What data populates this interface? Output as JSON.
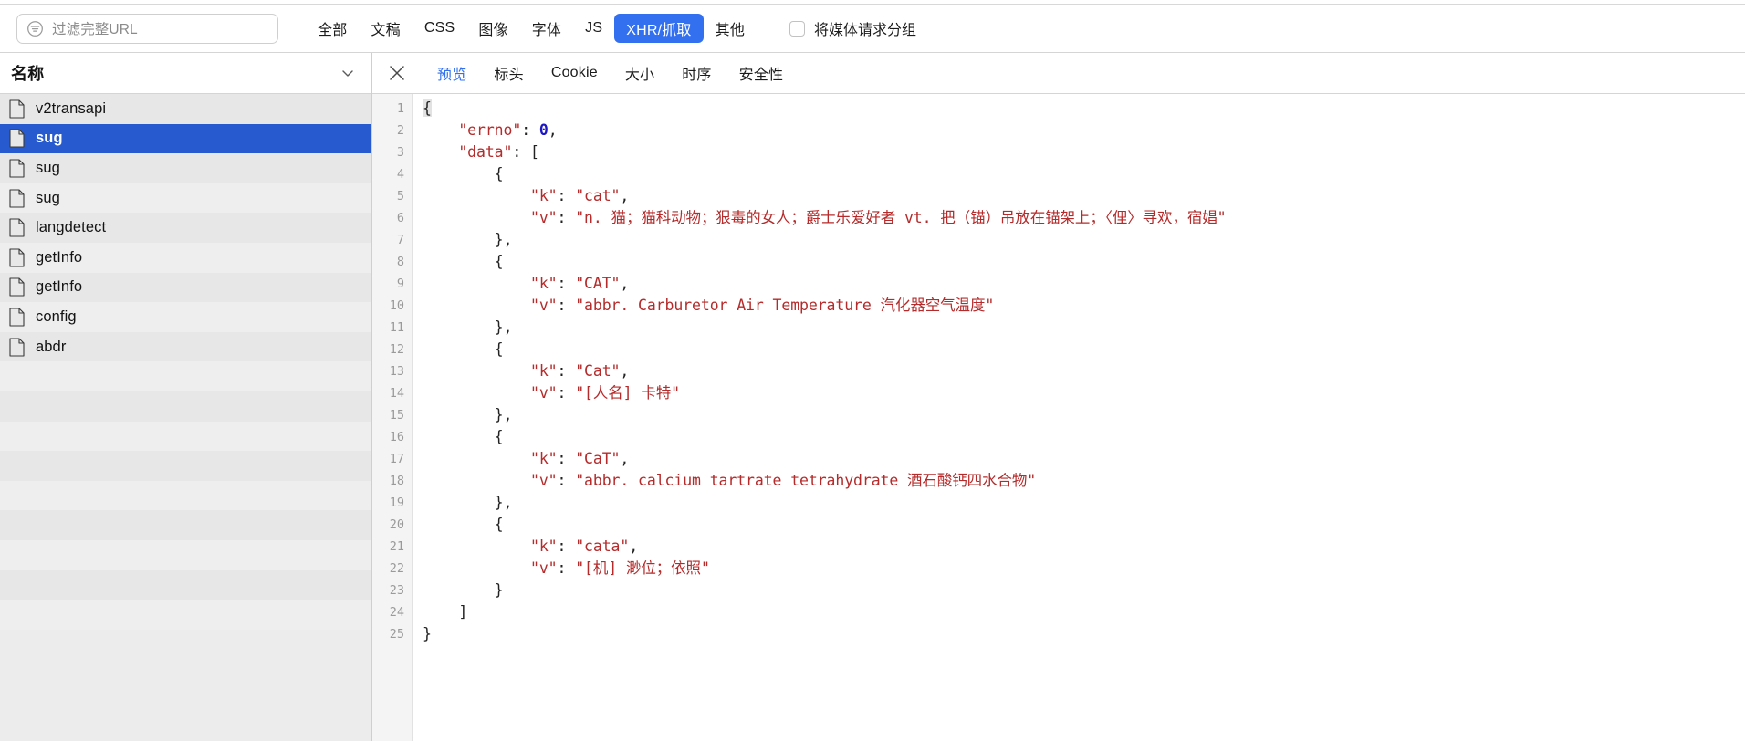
{
  "toolbar": {
    "filter": {
      "placeholder": "过滤完整URL",
      "value": "",
      "icon": "filter-icon"
    },
    "type_filters": [
      {
        "label": "全部",
        "active": false
      },
      {
        "label": "文稿",
        "active": false
      },
      {
        "label": "CSS",
        "active": false
      },
      {
        "label": "图像",
        "active": false
      },
      {
        "label": "字体",
        "active": false
      },
      {
        "label": "JS",
        "active": false
      },
      {
        "label": "XHR/抓取",
        "active": true
      },
      {
        "label": "其他",
        "active": false
      }
    ],
    "group_media": {
      "label": "将媒体请求分组",
      "checked": false
    },
    "active_accent": "#3370f0"
  },
  "sidebar": {
    "header": {
      "title": "名称",
      "collapse_icon": "chevron-down-icon"
    },
    "selected_index": 1,
    "selection_color": "#2759cf",
    "items": [
      {
        "name": "v2transapi"
      },
      {
        "name": "sug"
      },
      {
        "name": "sug"
      },
      {
        "name": "sug"
      },
      {
        "name": "langdetect"
      },
      {
        "name": "getInfo"
      },
      {
        "name": "getInfo"
      },
      {
        "name": "config"
      },
      {
        "name": "abdr"
      }
    ],
    "empty_rows": 9
  },
  "detail": {
    "close_icon": "close-icon",
    "tabs": [
      {
        "label": "预览",
        "active": true
      },
      {
        "label": "标头",
        "active": false
      },
      {
        "label": "Cookie",
        "active": false
      },
      {
        "label": "大小",
        "active": false
      },
      {
        "label": "时序",
        "active": false
      },
      {
        "label": "安全性",
        "active": false
      }
    ],
    "active_tab_color": "#3370f0"
  },
  "preview": {
    "string_color": "#b52b2b",
    "number_color": "#1c16c4",
    "punct_color": "#222222",
    "line_numbers": [
      1,
      2,
      3,
      4,
      5,
      6,
      7,
      8,
      9,
      10,
      11,
      12,
      13,
      14,
      15,
      16,
      17,
      18,
      19,
      20,
      21,
      22,
      23,
      24,
      25
    ],
    "lines": [
      {
        "n": 1,
        "indent": 0,
        "tokens": [
          {
            "t": "punc",
            "v": "{"
          }
        ],
        "first": true
      },
      {
        "n": 2,
        "indent": 1,
        "tokens": [
          {
            "t": "str",
            "v": "\"errno\""
          },
          {
            "t": "punc",
            "v": ": "
          },
          {
            "t": "num",
            "v": "0"
          },
          {
            "t": "punc",
            "v": ","
          }
        ]
      },
      {
        "n": 3,
        "indent": 1,
        "tokens": [
          {
            "t": "str",
            "v": "\"data\""
          },
          {
            "t": "punc",
            "v": ": ["
          }
        ]
      },
      {
        "n": 4,
        "indent": 2,
        "tokens": [
          {
            "t": "punc",
            "v": "{"
          }
        ]
      },
      {
        "n": 5,
        "indent": 3,
        "tokens": [
          {
            "t": "str",
            "v": "\"k\""
          },
          {
            "t": "punc",
            "v": ": "
          },
          {
            "t": "str",
            "v": "\"cat\""
          },
          {
            "t": "punc",
            "v": ","
          }
        ]
      },
      {
        "n": 6,
        "indent": 3,
        "tokens": [
          {
            "t": "str",
            "v": "\"v\""
          },
          {
            "t": "punc",
            "v": ": "
          },
          {
            "t": "str",
            "v": "\"n. 猫；猫科动物；狠毒的女人；爵士乐爱好者 vt. 把（锚）吊放在锚架上；〈俚〉寻欢，宿娼\""
          }
        ]
      },
      {
        "n": 7,
        "indent": 2,
        "tokens": [
          {
            "t": "punc",
            "v": "},"
          }
        ]
      },
      {
        "n": 8,
        "indent": 2,
        "tokens": [
          {
            "t": "punc",
            "v": "{"
          }
        ]
      },
      {
        "n": 9,
        "indent": 3,
        "tokens": [
          {
            "t": "str",
            "v": "\"k\""
          },
          {
            "t": "punc",
            "v": ": "
          },
          {
            "t": "str",
            "v": "\"CAT\""
          },
          {
            "t": "punc",
            "v": ","
          }
        ]
      },
      {
        "n": 10,
        "indent": 3,
        "tokens": [
          {
            "t": "str",
            "v": "\"v\""
          },
          {
            "t": "punc",
            "v": ": "
          },
          {
            "t": "str",
            "v": "\"abbr. Carburetor Air Temperature 汽化器空气温度\""
          }
        ]
      },
      {
        "n": 11,
        "indent": 2,
        "tokens": [
          {
            "t": "punc",
            "v": "},"
          }
        ]
      },
      {
        "n": 12,
        "indent": 2,
        "tokens": [
          {
            "t": "punc",
            "v": "{"
          }
        ]
      },
      {
        "n": 13,
        "indent": 3,
        "tokens": [
          {
            "t": "str",
            "v": "\"k\""
          },
          {
            "t": "punc",
            "v": ": "
          },
          {
            "t": "str",
            "v": "\"Cat\""
          },
          {
            "t": "punc",
            "v": ","
          }
        ]
      },
      {
        "n": 14,
        "indent": 3,
        "tokens": [
          {
            "t": "str",
            "v": "\"v\""
          },
          {
            "t": "punc",
            "v": ": "
          },
          {
            "t": "str",
            "v": "\"[人名] 卡特\""
          }
        ]
      },
      {
        "n": 15,
        "indent": 2,
        "tokens": [
          {
            "t": "punc",
            "v": "},"
          }
        ]
      },
      {
        "n": 16,
        "indent": 2,
        "tokens": [
          {
            "t": "punc",
            "v": "{"
          }
        ]
      },
      {
        "n": 17,
        "indent": 3,
        "tokens": [
          {
            "t": "str",
            "v": "\"k\""
          },
          {
            "t": "punc",
            "v": ": "
          },
          {
            "t": "str",
            "v": "\"CaT\""
          },
          {
            "t": "punc",
            "v": ","
          }
        ]
      },
      {
        "n": 18,
        "indent": 3,
        "tokens": [
          {
            "t": "str",
            "v": "\"v\""
          },
          {
            "t": "punc",
            "v": ": "
          },
          {
            "t": "str",
            "v": "\"abbr. calcium tartrate tetrahydrate 酒石酸钙四水合物\""
          }
        ]
      },
      {
        "n": 19,
        "indent": 2,
        "tokens": [
          {
            "t": "punc",
            "v": "},"
          }
        ]
      },
      {
        "n": 20,
        "indent": 2,
        "tokens": [
          {
            "t": "punc",
            "v": "{"
          }
        ]
      },
      {
        "n": 21,
        "indent": 3,
        "tokens": [
          {
            "t": "str",
            "v": "\"k\""
          },
          {
            "t": "punc",
            "v": ": "
          },
          {
            "t": "str",
            "v": "\"cata\""
          },
          {
            "t": "punc",
            "v": ","
          }
        ]
      },
      {
        "n": 22,
        "indent": 3,
        "tokens": [
          {
            "t": "str",
            "v": "\"v\""
          },
          {
            "t": "punc",
            "v": ": "
          },
          {
            "t": "str",
            "v": "\"[机] 渺位；依照\""
          }
        ]
      },
      {
        "n": 23,
        "indent": 2,
        "tokens": [
          {
            "t": "punc",
            "v": "}"
          }
        ]
      },
      {
        "n": 24,
        "indent": 1,
        "tokens": [
          {
            "t": "punc",
            "v": "]"
          }
        ]
      },
      {
        "n": 25,
        "indent": 0,
        "tokens": [
          {
            "t": "punc",
            "v": "}"
          }
        ]
      }
    ],
    "response_json": {
      "errno": 0,
      "data": [
        {
          "k": "cat",
          "v": "n. 猫；猫科动物；狠毒的女人；爵士乐爱好者 vt. 把（锚）吊放在锚架上；〈俚〉寻欢，宿娼"
        },
        {
          "k": "CAT",
          "v": "abbr. Carburetor Air Temperature 汽化器空气温度"
        },
        {
          "k": "Cat",
          "v": "[人名] 卡特"
        },
        {
          "k": "CaT",
          "v": "abbr. calcium tartrate tetrahydrate 酒石酸钙四水合物"
        },
        {
          "k": "cata",
          "v": "[机] 渺位；依照"
        }
      ]
    }
  }
}
